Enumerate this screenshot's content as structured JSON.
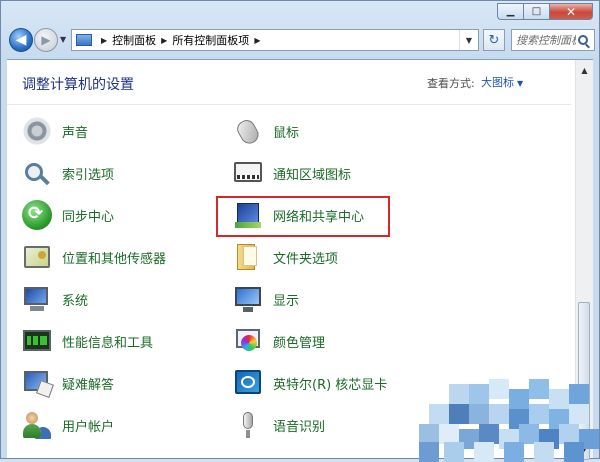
{
  "window": {
    "minimize_glyph": "▁",
    "maximize_glyph": "□",
    "close_glyph": "✕"
  },
  "nav": {
    "back_glyph": "◀",
    "forward_glyph": "▶",
    "dropdown_glyph": "▼",
    "breadcrumbs": [
      "控制面板",
      "所有控制面板项"
    ],
    "crumb_separator": "▶",
    "search_placeholder": "搜索控制面板",
    "refresh_glyph": "↻"
  },
  "header": {
    "title": "调整计算机的设置",
    "view_by_label": "查看方式:",
    "view_by_value": "大图标"
  },
  "items": [
    {
      "label": "声音",
      "icon": "speaker-icon"
    },
    {
      "label": "鼠标",
      "icon": "mouse-icon"
    },
    {
      "label": "索引选项",
      "icon": "index-options-icon"
    },
    {
      "label": "通知区域图标",
      "icon": "notification-area-icon"
    },
    {
      "label": "同步中心",
      "icon": "sync-center-icon"
    },
    {
      "label": "网络和共享中心",
      "icon": "network-sharing-icon"
    },
    {
      "label": "位置和其他传感器",
      "icon": "location-sensors-icon"
    },
    {
      "label": "文件夹选项",
      "icon": "folder-options-icon"
    },
    {
      "label": "系统",
      "icon": "system-icon"
    },
    {
      "label": "显示",
      "icon": "display-icon"
    },
    {
      "label": "性能信息和工具",
      "icon": "performance-icon"
    },
    {
      "label": "颜色管理",
      "icon": "color-management-icon"
    },
    {
      "label": "疑难解答",
      "icon": "troubleshooting-icon"
    },
    {
      "label": "英特尔(R) 核芯显卡",
      "icon": "intel-graphics-icon"
    },
    {
      "label": "用户帐户",
      "icon": "user-accounts-icon"
    },
    {
      "label": "语音识别",
      "icon": "speech-recognition-icon"
    }
  ],
  "colors": {
    "link_green": "#1a6b26",
    "title_blue": "#1e3287",
    "highlight_red": "#d62828"
  }
}
